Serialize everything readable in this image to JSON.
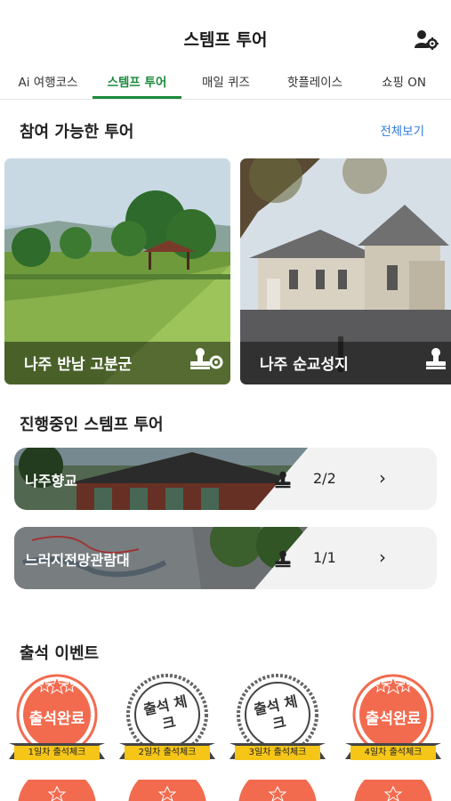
{
  "header": {
    "title": "스템프 투어",
    "settings_icon": "user-settings-icon"
  },
  "tabs": [
    {
      "label": "Ai 여행코스",
      "active": false
    },
    {
      "label": "스템프 투어",
      "active": true
    },
    {
      "label": "매일 퀴즈",
      "active": false
    },
    {
      "label": "핫플레이스",
      "active": false
    },
    {
      "label": "쇼핑 ON",
      "active": false
    }
  ],
  "available_tours": {
    "title": "참여 가능한 투어",
    "view_all": "전체보기",
    "cards": [
      {
        "name": "나주 반남 고분군",
        "icon": "stamp-icon"
      },
      {
        "name": "나주 순교성지",
        "icon": "stamp-icon"
      }
    ]
  },
  "ongoing_tours": {
    "title": "진행중인 스템프 투어",
    "items": [
      {
        "name": "나주향교",
        "count": "2/2"
      },
      {
        "name": "느러지전망관람대",
        "count": "1/1"
      }
    ]
  },
  "attendance": {
    "title": "출석 이벤트",
    "badges": [
      {
        "main": "출석완료",
        "ribbon": "1일차 출석체크",
        "state": "completed"
      },
      {
        "main": "출석 체크",
        "ribbon": "2일차 출석체크",
        "state": "pending"
      },
      {
        "main": "출석 체크",
        "ribbon": "3일차 출석체크",
        "state": "pending"
      },
      {
        "main": "출석완료",
        "ribbon": "4일차 출석체크",
        "state": "completed"
      }
    ]
  },
  "colors": {
    "accent": "#1b8a3a",
    "link": "#2f7be0",
    "badge_orange": "#f26b4f",
    "ribbon": "#f5c518"
  }
}
